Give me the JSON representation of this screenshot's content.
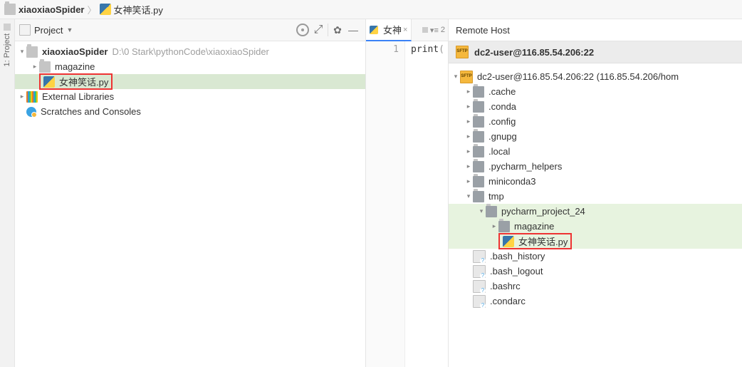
{
  "breadcrumb": {
    "root": "xiaoxiaoSpider",
    "file": "女神笑话.py"
  },
  "project_panel": {
    "title": "Project",
    "root_name": "xiaoxiaoSpider",
    "root_path": "D:\\0    Stark\\pythonCode\\xiaoxiaoSpider",
    "children": {
      "magazine": "magazine",
      "file_py": "女神笑话.py"
    },
    "external": "External Libraries",
    "scratches": "Scratches and Consoles"
  },
  "editor": {
    "tab_label": "女神",
    "line_no": "1",
    "code_snip": "print",
    "indicator": "2"
  },
  "remote": {
    "title": "Remote Host",
    "header": "dc2-user@116.85.54.206:22",
    "root_label": "dc2-user@116.85.54.206:22 (116.85.54.206/hom",
    "nodes": {
      "cache": ".cache",
      "conda": ".conda",
      "config": ".config",
      "gnupg": ".gnupg",
      "local": ".local",
      "pych_help": ".pycharm_helpers",
      "miniconda": "miniconda3",
      "tmp": "tmp",
      "pyproj": "pycharm_project_24",
      "magazine": "magazine",
      "file_py": "女神笑话.py",
      "bash_history": ".bash_history",
      "bash_logout": ".bash_logout",
      "bashrc": ".bashrc",
      "condarc": ".condarc"
    }
  }
}
